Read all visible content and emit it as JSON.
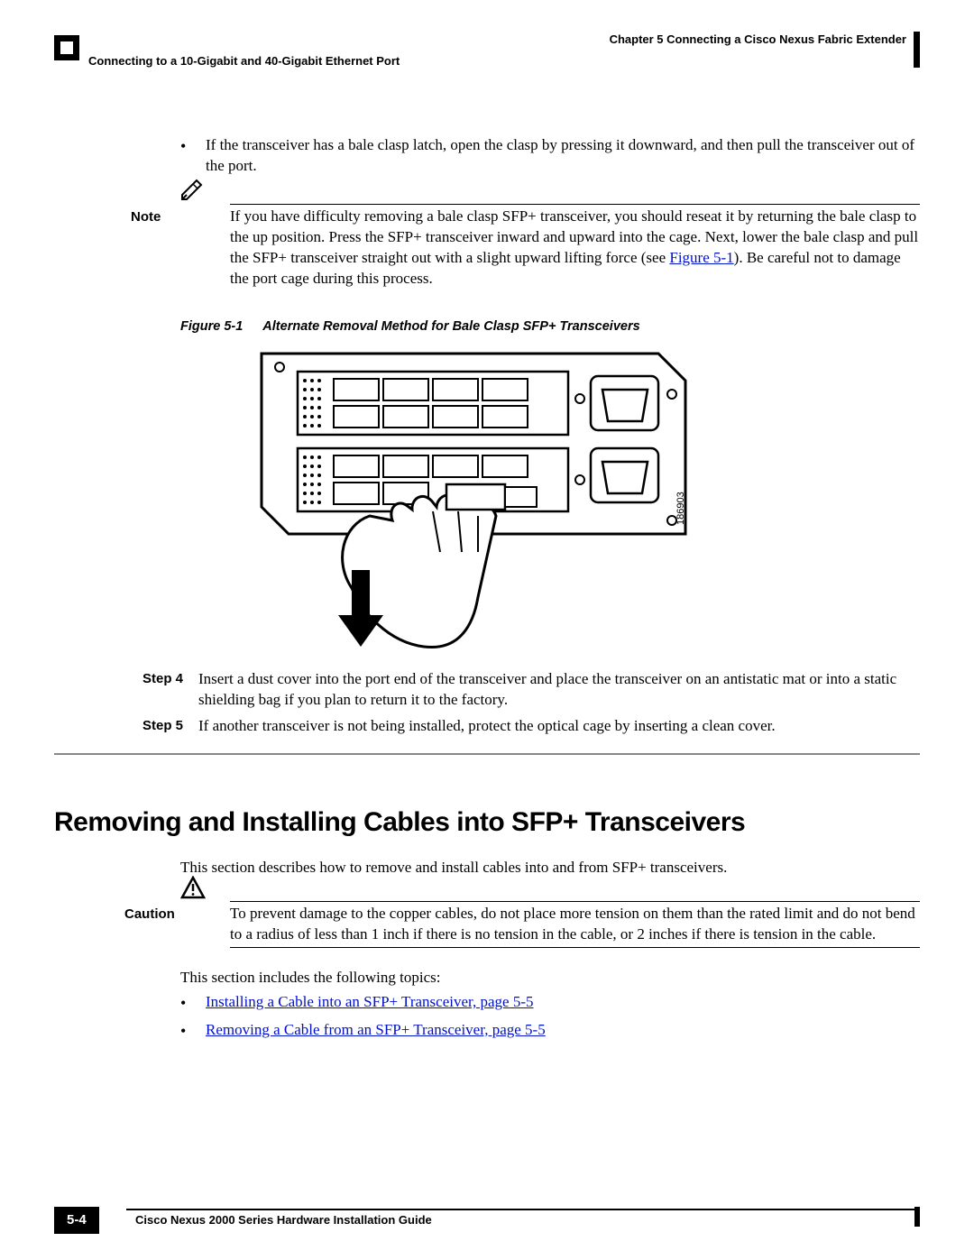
{
  "header": {
    "chapter": "Chapter 5    Connecting a Cisco Nexus Fabric Extender",
    "section": "Connecting to a 10-Gigabit and 40-Gigabit Ethernet Port"
  },
  "bullet1": "If the transceiver has a bale clasp latch, open the clasp by pressing it downward, and then pull the transceiver out of the port.",
  "note1": {
    "label": "Note",
    "text_before_link": "If you have difficulty removing a bale clasp SFP+ transceiver, you should reseat it by returning the bale clasp to the up position. Press the SFP+ transceiver inward and upward into the cage. Next, lower the bale clasp and pull the SFP+ transceiver straight out with a slight upward lifting force (see ",
    "link_text": "Figure 5-1",
    "text_after_link": "). Be careful not to damage the port cage during this process."
  },
  "figure": {
    "num": "Figure 5-1",
    "title": "Alternate Removal Method for Bale Clasp SFP+ Transceivers",
    "label": "186903"
  },
  "steps": {
    "s4": {
      "label": "Step 4",
      "text": "Insert a dust cover into the port end of the transceiver and place the transceiver on an antistatic mat or into a static shielding bag if you plan to return it to the factory."
    },
    "s5": {
      "label": "Step 5",
      "text": "If another transceiver is not being installed, protect the optical cage by inserting a clean cover."
    }
  },
  "heading": "Removing and Installing Cables into SFP+ Transceivers",
  "intro": "This section describes how to remove and install cables into and from SFP+ transceivers.",
  "caution": {
    "label": "Caution",
    "text": "To prevent damage to the copper cables, do not place more tension on them than the rated limit and do not bend to a radius of less than 1 inch if there is no tension in the cable, or 2 inches if there is tension in the cable."
  },
  "topics_intro": "This section includes the following topics:",
  "topics": {
    "t1": "Installing a Cable into an SFP+ Transceiver, page 5-5",
    "t2": "Removing a Cable from an SFP+ Transceiver, page 5-5"
  },
  "footer": {
    "title": "Cisco Nexus 2000 Series Hardware Installation Guide",
    "page": "5-4"
  }
}
